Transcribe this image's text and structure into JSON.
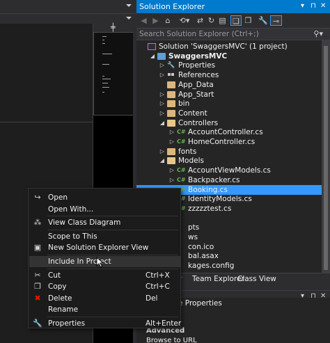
{
  "solution_explorer": {
    "title": "Solution Explorer",
    "title_controls": {
      "dropdown": "▾",
      "pin": "⊓",
      "close": "✕"
    },
    "search_placeholder": "Search Solution Explorer (Ctrl+;)",
    "tree": [
      {
        "label": "Solution 'SwaggersMVC' (1 project)",
        "icon": "solution-icon",
        "indent": 0,
        "expander": ""
      },
      {
        "label": "SwaggersMVC",
        "icon": "project-icon",
        "indent": 1,
        "expander": "expanded",
        "bold": true
      },
      {
        "label": "Properties",
        "icon": "wrench-icon",
        "indent": 2,
        "expander": "collapsed"
      },
      {
        "label": "References",
        "icon": "references-icon",
        "indent": 2,
        "expander": "collapsed"
      },
      {
        "label": "App_Data",
        "icon": "folder-icon",
        "indent": 2,
        "expander": ""
      },
      {
        "label": "App_Start",
        "icon": "folder-icon",
        "indent": 2,
        "expander": "collapsed"
      },
      {
        "label": "bin",
        "icon": "folder-icon",
        "indent": 2,
        "expander": "collapsed"
      },
      {
        "label": "Content",
        "icon": "folder-icon",
        "indent": 2,
        "expander": "collapsed"
      },
      {
        "label": "Controllers",
        "icon": "folder-open-icon",
        "indent": 2,
        "expander": "expanded"
      },
      {
        "label": "AccountController.cs",
        "icon": "csharp-file-icon",
        "indent": 3,
        "expander": "collapsed"
      },
      {
        "label": "HomeController.cs",
        "icon": "csharp-file-icon",
        "indent": 3,
        "expander": "collapsed"
      },
      {
        "label": "fonts",
        "icon": "folder-icon",
        "indent": 2,
        "expander": "collapsed"
      },
      {
        "label": "Models",
        "icon": "folder-open-icon",
        "indent": 2,
        "expander": "expanded"
      },
      {
        "label": "AccountViewModels.cs",
        "icon": "csharp-file-icon",
        "indent": 3,
        "expander": "collapsed"
      },
      {
        "label": "Backpacker.cs",
        "icon": "csharp-file-icon",
        "indent": 3,
        "expander": "collapsed"
      },
      {
        "label": "Booking.cs",
        "icon": "csharp-file-icon",
        "indent": 3,
        "expander": "collapsed",
        "selected": true
      },
      {
        "label": "IdentityModels.cs",
        "icon": "csharp-file-icon",
        "indent": 3,
        "expander": ""
      },
      {
        "label": "zzzzztest.cs",
        "icon": "csharp-file-icon",
        "indent": 3,
        "expander": ""
      },
      {
        "label": "",
        "icon": "",
        "indent": 3,
        "expander": ""
      },
      {
        "label": "pts",
        "icon": "",
        "indent": 3,
        "expander": ""
      },
      {
        "label": "ws",
        "icon": "",
        "indent": 3,
        "expander": ""
      },
      {
        "label": "con.ico",
        "icon": "",
        "indent": 3,
        "expander": ""
      },
      {
        "label": "bal.asax",
        "icon": "",
        "indent": 3,
        "expander": ""
      },
      {
        "label": "kages.config",
        "icon": "",
        "indent": 3,
        "expander": ""
      }
    ],
    "tabs": [
      "r",
      "Team Explorer",
      "Class View"
    ]
  },
  "properties_pane": {
    "title": "e Properties",
    "controls": {
      "dropdown": "▾",
      "pin": "⊓",
      "close": "✕"
    },
    "rows": [
      "Advanced",
      "Browse to URL"
    ]
  },
  "context_menu": {
    "items": [
      {
        "label": "Open",
        "shortcut": "",
        "icon": "open-icon",
        "glyph": "↪"
      },
      {
        "label": "Open With...",
        "shortcut": "",
        "icon": "",
        "glyph": ""
      },
      {
        "separator": true
      },
      {
        "label": "View Class Diagram",
        "shortcut": "",
        "icon": "class-diagram-icon",
        "glyph": "⁂"
      },
      {
        "separator": true
      },
      {
        "label": "Scope to This",
        "shortcut": "",
        "icon": "",
        "glyph": ""
      },
      {
        "label": "New Solution Explorer View",
        "shortcut": "",
        "icon": "new-view-icon",
        "glyph": "▣"
      },
      {
        "separator": true
      },
      {
        "label": "Include In Project",
        "shortcut": "",
        "icon": "",
        "glyph": "",
        "highlighted": true
      },
      {
        "separator": true
      },
      {
        "label": "Cut",
        "shortcut": "Ctrl+X",
        "icon": "cut-icon",
        "glyph": "✂"
      },
      {
        "label": "Copy",
        "shortcut": "Ctrl+C",
        "icon": "copy-icon",
        "glyph": "❐"
      },
      {
        "label": "Delete",
        "shortcut": "Del",
        "icon": "delete-icon",
        "glyph": "✖",
        "glyph_color": "#e51400"
      },
      {
        "label": "Rename",
        "shortcut": "",
        "icon": "",
        "glyph": ""
      },
      {
        "separator": true
      },
      {
        "label": "Properties",
        "shortcut": "Alt+Enter",
        "icon": "wrench-icon",
        "glyph": "🔧"
      }
    ]
  },
  "colors": {
    "accent": "#007acc",
    "selection": "#3399ff",
    "background": "#2d2d30",
    "csharp_icon": "#68b54d",
    "folder_icon": "#dcb67a"
  }
}
